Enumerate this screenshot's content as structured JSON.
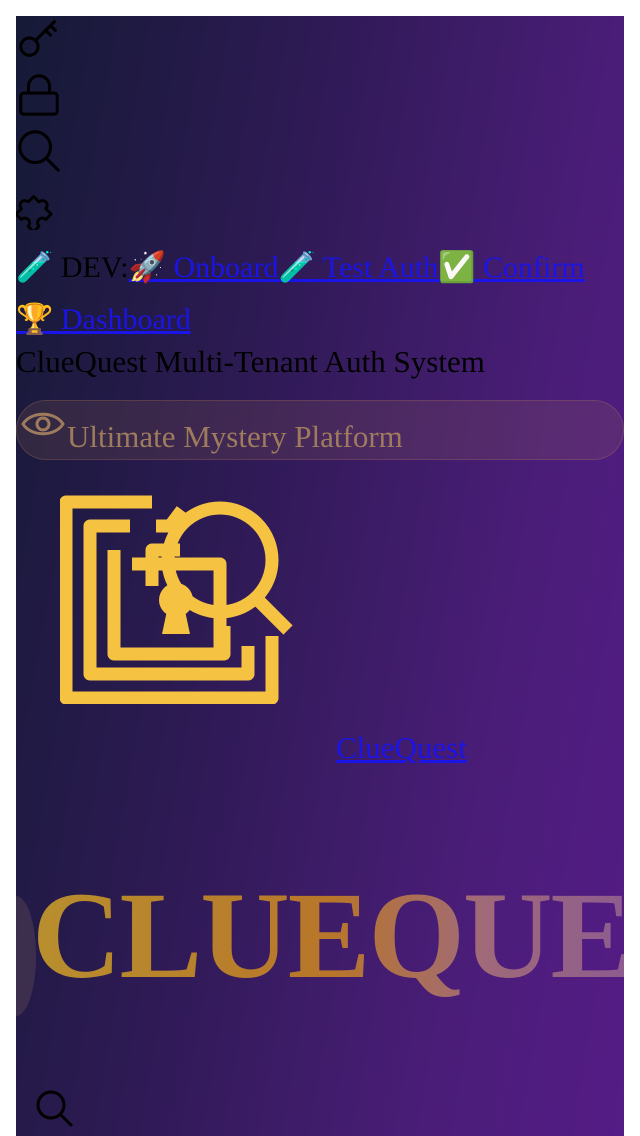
{
  "icons": [
    "key-icon",
    "lock-icon",
    "search-icon",
    "puzzle-icon"
  ],
  "dev_bar": {
    "test_emoji": "🧪",
    "label": " DEV:",
    "onboard": "🚀  Onboard",
    "test_auth": "🧪  Test Auth",
    "confirm": "✅  Confirm"
  },
  "dashboard": "🏆  Dashboard",
  "system_title": "ClueQuest Multi-Tenant Auth System",
  "tagline": "Ultimate Mystery Platform",
  "brand_link": "ClueQuest",
  "hero_text": "CLUEQUEST",
  "colors": {
    "accent_gold": "#f5c242",
    "link_blue": "#1a14e6",
    "bg_dark": "#151a36",
    "bg_purple": "#541c86"
  }
}
